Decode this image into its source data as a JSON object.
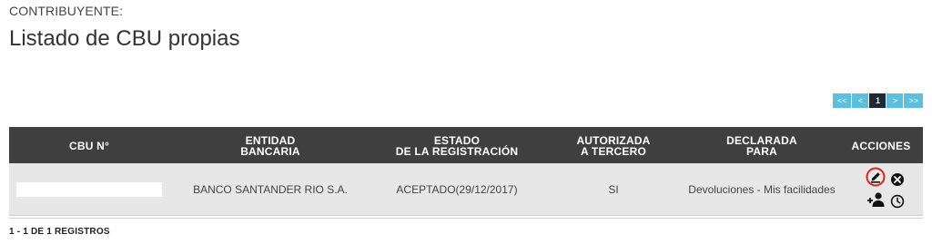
{
  "header": {
    "subtitle": "CONTRIBUYENTE:",
    "title": "Listado de CBU propias"
  },
  "pagination": {
    "first": "<<",
    "prev": "<",
    "current": "1",
    "next": ">",
    "last": ">>"
  },
  "table": {
    "columns": [
      "CBU N°",
      "ENTIDAD\nBANCARIA",
      "ESTADO\nDE LA REGISTRACIÓN",
      "AUTORIZADA\nA TERCERO",
      "DECLARADA\nPARA",
      "ACCIONES"
    ],
    "rows": [
      {
        "cbu": "",
        "entidad": "BANCO SANTANDER RIO S.A.",
        "estado": "ACEPTADO(29/12/2017)",
        "autorizada": "SI",
        "declarada": "Devoluciones - Mis facilidades"
      }
    ]
  },
  "footer": {
    "records": "1 - 1 DE 1 REGISTROS"
  },
  "colors": {
    "header_bg": "#3f3f3f",
    "row_bg": "#e7e7e7",
    "pager_bg": "#5bc0de",
    "pager_active_bg": "#1f2a35",
    "highlight_ring": "#e0201b"
  },
  "icons": {
    "edit": "pencil-icon",
    "delete": "close-circle-icon",
    "add_person": "add-person-icon",
    "history": "clock-icon"
  }
}
